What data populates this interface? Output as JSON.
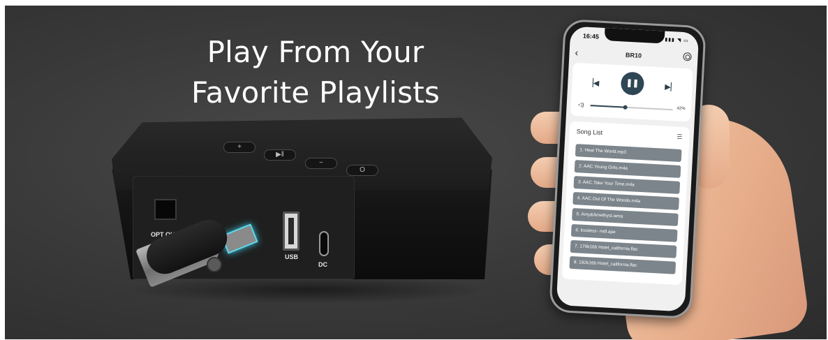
{
  "headline": {
    "line1": "Play From Your",
    "line2": "Favorite Playlists"
  },
  "device": {
    "buttons": [
      "+",
      "▶‖",
      "−",
      "O"
    ],
    "ports": {
      "optical": "OPT OUT",
      "usb": "USB",
      "dc": "DC"
    }
  },
  "phone": {
    "status_time": "16:45",
    "status_icons": "▮▮▮ ◥ ▭",
    "title": "BR10",
    "back_glyph": "‹",
    "player": {
      "prev_glyph": "▕◀",
      "play_glyph": "❚❚",
      "next_glyph": "▶▏",
      "volume_glyph": "◁)",
      "volume_percent": 42,
      "volume_label": "42%"
    },
    "song_list": {
      "title": "Song List",
      "list_glyph": "☰",
      "items": [
        "1. Heal The World.mp3",
        "2. AAC.Young Girls.m4a",
        "3. AAC.Take Your Time.m4a",
        "4. AAC.Out Of The Woods.m4a",
        "5. Amy&Amethyst.wma",
        "6. lossless- mdl.ape",
        "7. 176k16b Hotel_california.flac",
        "8. 192k16b Hotel_california.flac"
      ]
    }
  }
}
